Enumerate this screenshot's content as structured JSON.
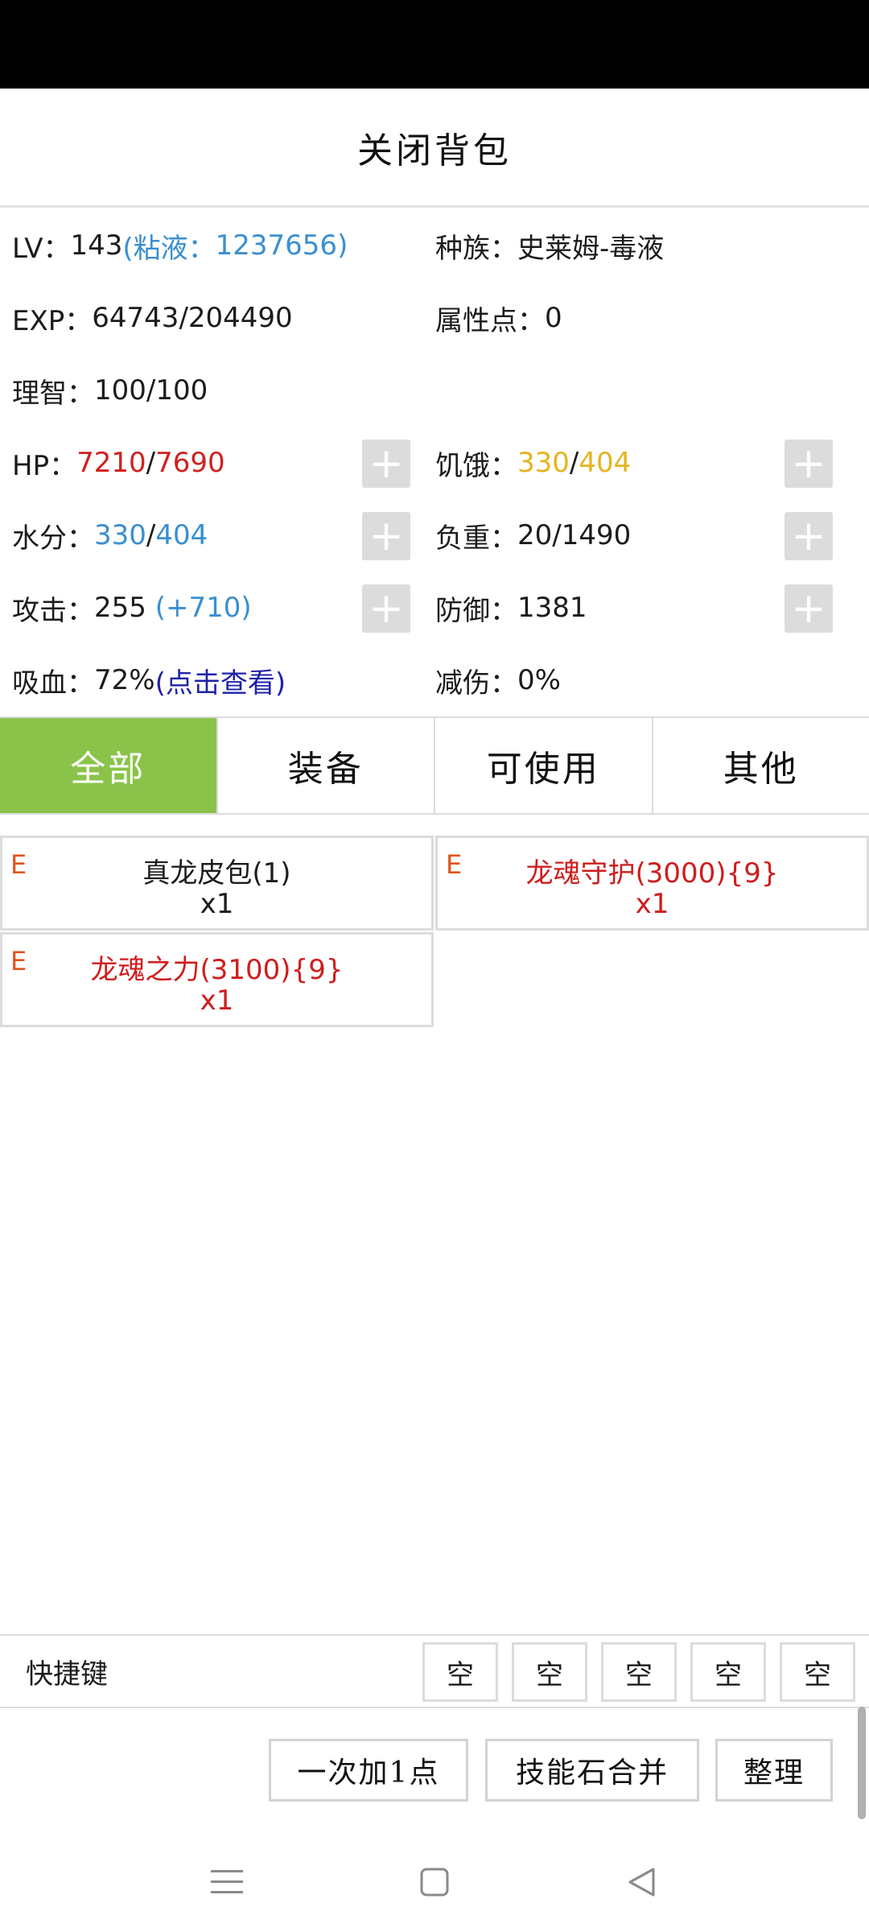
{
  "header": {
    "title": "关闭背包"
  },
  "stats": {
    "lv": {
      "label": "LV：",
      "value": "143",
      "slime_open": "(粘液：",
      "slime_value": "1237656",
      "slime_close": ")"
    },
    "race": {
      "label": "种族：",
      "value": "史莱姆-毒液"
    },
    "exp": {
      "label": "EXP：",
      "value": "64743/204490"
    },
    "attr_points": {
      "label": "属性点：",
      "value": "0"
    },
    "sanity": {
      "label": "理智：",
      "value": "100/100"
    },
    "hp": {
      "label": "HP：",
      "current": "7210",
      "sep": "/",
      "max": "7690"
    },
    "hunger": {
      "label": "饥饿：",
      "current": "330",
      "sep": "/",
      "max": "404"
    },
    "water": {
      "label": "水分：",
      "current": "330",
      "sep": "/",
      "max": "404"
    },
    "load": {
      "label": "负重：",
      "value": "20/1490"
    },
    "attack": {
      "label": "攻击：",
      "value": "255 ",
      "bonus": "(+710)"
    },
    "defense": {
      "label": "防御：",
      "value": "1381"
    },
    "lifesteal": {
      "label": "吸血：",
      "value": "72%",
      "link": "(点击查看)"
    },
    "dmg_reduction": {
      "label": "减伤：",
      "value": "0%"
    },
    "plus_symbol": "+"
  },
  "tabs": [
    "全部",
    "装备",
    "可使用",
    "其他"
  ],
  "active_tab": "全部",
  "items": [
    {
      "tag": "E",
      "name": "真龙皮包(1)",
      "qty": "x1",
      "color": "#1c1c1c"
    },
    {
      "tag": "E",
      "name": "龙魂守护(3000){9}",
      "qty": "x1",
      "color": "#cf1d1d"
    },
    {
      "tag": "E",
      "name": "龙魂之力(3100){9}",
      "qty": "x1",
      "color": "#cf1d1d"
    }
  ],
  "quickbar": {
    "label": "快捷键",
    "slots": [
      "空",
      "空",
      "空",
      "空",
      "空"
    ]
  },
  "actions": {
    "add_one": "一次加1点",
    "merge_stones": "技能石合并",
    "sort": "整理"
  },
  "colors": {
    "accent_green": "#8bc34a",
    "blue": "#3a8fd0",
    "red": "#d12020",
    "yellow": "#e6b41e",
    "item_tag": "#e0541c"
  },
  "icons": {
    "navbar": [
      "menu-icon",
      "home-icon",
      "back-icon"
    ]
  }
}
